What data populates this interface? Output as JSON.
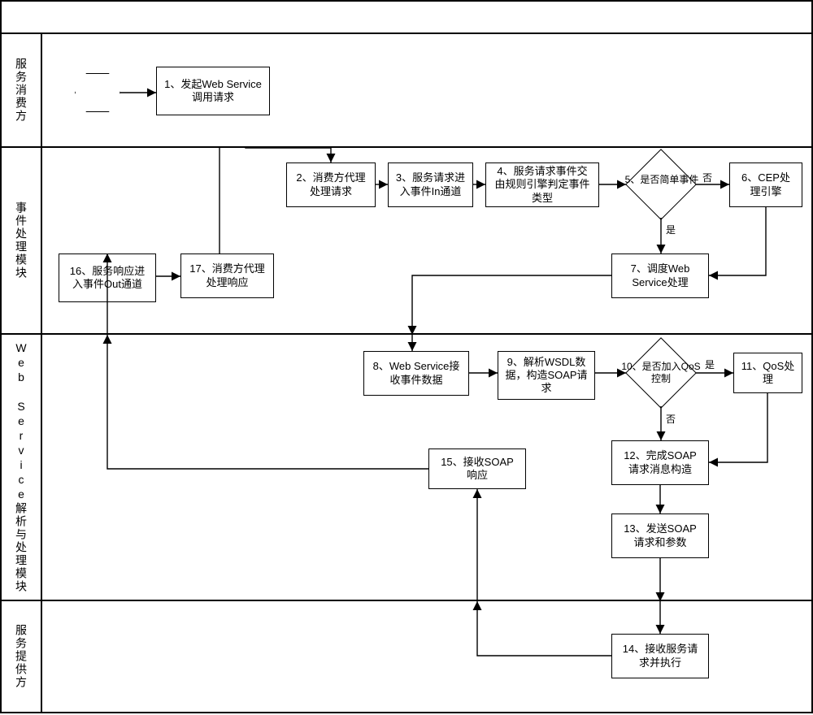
{
  "lanes": {
    "consumer": "服务消费方",
    "event": "事件处理模块",
    "ws": "Web Service解析与处理模块",
    "provider": "服务提供方"
  },
  "nodes": {
    "n1": "1、发起Web Service调用请求",
    "n2": "2、消费方代理处理请求",
    "n3": "3、服务请求进入事件In通道",
    "n4": "4、服务请求事件交由规则引擎判定事件类型",
    "n5": "5、是否简单事件",
    "n6": "6、CEP处理引擎",
    "n7": "7、调度Web Service处理",
    "n8": "8、Web Service接收事件数据",
    "n9": "9、解析WSDL数据，构造SOAP请求",
    "n10": "10、是否加入QoS控制",
    "n11": "11、QoS处理",
    "n12": "12、完成SOAP请求消息构造",
    "n13": "13、发送SOAP请求和参数",
    "n14": "14、接收服务请求并执行",
    "n15": "15、接收SOAP响应",
    "n16": "16、服务响应进入事件Out通道",
    "n17": "17、消费方代理处理响应"
  },
  "edges": {
    "yes": "是",
    "no": "否"
  }
}
